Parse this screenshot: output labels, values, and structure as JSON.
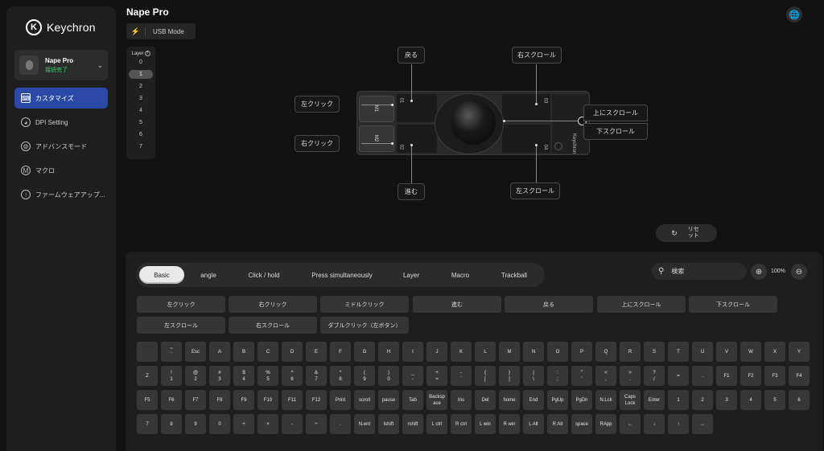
{
  "sidebar": {
    "brand": "Keychron",
    "brand_mark": "K",
    "device": {
      "name": "Nape Pro",
      "status": "接続完了"
    },
    "items": [
      {
        "label": "カスタマイズ",
        "icon": "keyboard-icon",
        "active": true
      },
      {
        "label": "DPI Setting",
        "icon": "gauge-icon",
        "active": false
      },
      {
        "label": "アドバンスモード",
        "icon": "gear-icon",
        "active": false
      },
      {
        "label": "マクロ",
        "icon": "macro-icon",
        "active": false
      },
      {
        "label": "ファームウェアアップ...",
        "icon": "upload-icon",
        "active": false
      }
    ]
  },
  "header": {
    "title": "Nape Pro",
    "mode": "USB Mode"
  },
  "layers": {
    "title": "Layer",
    "items": [
      "0",
      "1",
      "2",
      "3",
      "4",
      "5",
      "6",
      "7"
    ],
    "active": "1"
  },
  "device_diagram": {
    "buttons": {
      "m1": "M1",
      "m2": "M2"
    },
    "strips": {
      "s1": "01",
      "s2": "02",
      "s3": "03",
      "s4": "04"
    },
    "brand_vertical": "Keychron",
    "callouts": {
      "left_click": "左クリック",
      "right_click": "右クリック",
      "back": "戻る",
      "forward": "進む",
      "right_scroll": "右スクロール",
      "left_scroll": "左スクロール",
      "scroll_up": "上にスクロール",
      "scroll_down": "下スクロール"
    }
  },
  "reset": {
    "label": "リセット"
  },
  "tabs": [
    "Basic",
    "angle",
    "Click / hold",
    "Press simultaneously",
    "Layer",
    "Macro",
    "Trackball"
  ],
  "search": {
    "placeholder": "検索"
  },
  "zoom": {
    "value": "100%"
  },
  "actions": [
    [
      "左クリック",
      "右クリック",
      "ミドルクリック",
      "進む",
      "戻る",
      "上にスクロール",
      "下スクロール"
    ],
    [
      "左スクロール",
      "右スクロール",
      "ダブルクリック（左ボタン）"
    ]
  ],
  "keys": [
    [
      "",
      "~\n`",
      "Esc",
      "A",
      "B",
      "C",
      "D",
      "E",
      "F",
      "G",
      "H",
      "I",
      "J",
      "K",
      "L",
      "M",
      "N",
      "O",
      "P",
      "Q",
      "R",
      "S",
      "T",
      "U",
      "V",
      "W",
      "X",
      "Y"
    ],
    [
      "Z",
      "!\n1",
      "@\n2",
      "#\n3",
      "$\n4",
      "%\n5",
      "^\n6",
      "&\n7",
      "*\n8",
      "(\n9",
      ")\n0",
      "_\n-",
      "+\n=",
      "-\n`",
      "{\n[",
      "}\n]",
      "|\n\\",
      ":\n;",
      "\"\n'",
      "<\n,",
      ">\n.",
      "?\n/",
      "=",
      ".",
      "F1",
      "F2",
      "F3",
      "F4"
    ],
    [
      "F5",
      "F6",
      "F7",
      "F8",
      "F9",
      "F10",
      "F11",
      "F12",
      "Print",
      "scroll",
      "pause",
      "Tab",
      "Backsp\nace",
      "Ins",
      "Del",
      "home",
      "End",
      "PgUp",
      "PgDn",
      "N.Lck",
      "Caps\nLock",
      "Enter",
      "1",
      "2",
      "3",
      "4",
      "5",
      "6"
    ],
    [
      "7",
      "8",
      "9",
      "0",
      "+",
      "×",
      "-",
      "÷",
      ".",
      "N.ent",
      "lshift",
      "rshift",
      "L ctrl",
      "R ctrl",
      "L win",
      "R win",
      "L Alt",
      "R Alt",
      "space",
      "RApp",
      "←",
      "↓",
      "↑",
      "→"
    ]
  ],
  "colors": {
    "accent": "#2b4aa8",
    "connected": "#3ecf6e",
    "background": "#121212"
  }
}
